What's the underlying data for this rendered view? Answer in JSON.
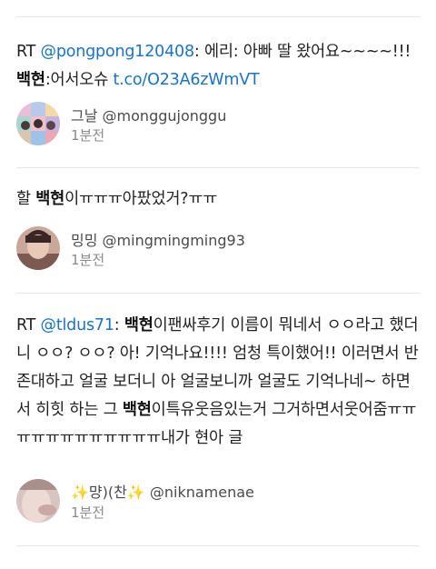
{
  "tweets": [
    {
      "text": {
        "rt": "RT ",
        "mention": "@pongpong120408",
        "p1": ": 에리: 아빠 딸 왔어요~~~~!!!",
        "bold1": "백현",
        "p2": ":어서오슈 ",
        "link": "t.co/O23A6zWmVT"
      },
      "author": {
        "name": "그날",
        "handle": "@monggujonggu"
      },
      "time": "1분전"
    },
    {
      "text": {
        "p1": "할 ",
        "bold1": "백현",
        "p2": "이ㅠㅠㅠ아팠었거?ㅠㅠ"
      },
      "author": {
        "name": "밍밍",
        "handle": "@mingmingming93"
      },
      "time": "1분전"
    },
    {
      "text": {
        "rt": "RT ",
        "mention": "@tldus71",
        "p1": ": ",
        "bold1": "백현",
        "p2": "이팬싸후기 이름이 뭐네서 ㅇㅇ라고 했더니 ㅇㅇ? ㅇㅇ? 아! 기억나요!!!! 엄청 특이했어!! 이러면서 반존대하고 얼굴 보더니 아 얼굴보니까 얼굴도 기억나네~ 하면서 히힛 하는 그 ",
        "bold2": "백현",
        "p3": "이특유웃음있는거 그거하면서웃어줌ㅠㅠㅠㅠㅠㅠㅠㅠㅠㅠㅠㅠ내가 현아 글"
      },
      "author": {
        "name": "✨먕)(찬✨",
        "handle": "@niknamenae"
      },
      "time": "1분전"
    }
  ],
  "colors": {
    "link": "#1a73c9",
    "divider": "#e6e6e6",
    "muted": "#8a8a8a"
  }
}
